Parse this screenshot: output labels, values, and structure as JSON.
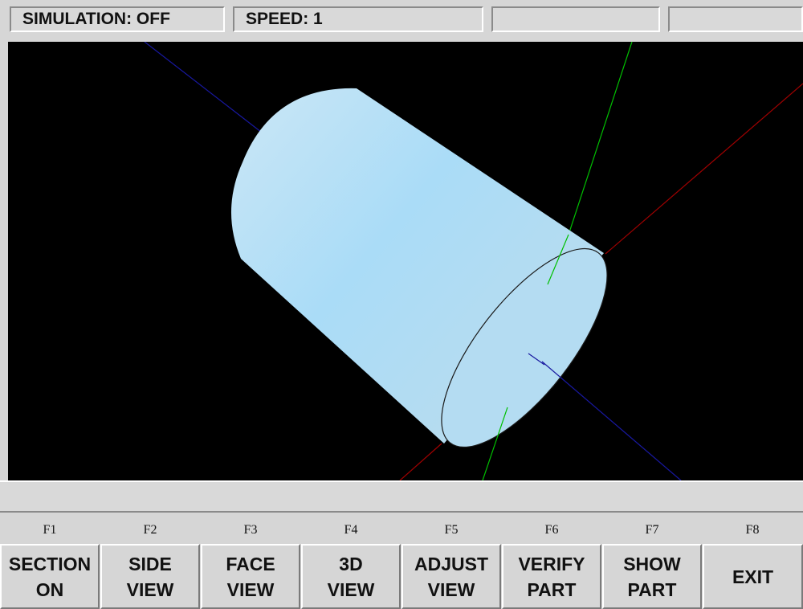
{
  "status_bar": {
    "simulation": "SIMULATION: OFF",
    "speed": "SPEED: 1",
    "field3": "",
    "field4": ""
  },
  "viewport": {
    "background": "#000000",
    "part_color": "#a9dcf5",
    "axis_colors": {
      "x": "#a00000",
      "y": "#00c000",
      "z": "#1010a0"
    }
  },
  "message_bar": {
    "text": ""
  },
  "function_keys": [
    {
      "key": "F1",
      "line1": "SECTION",
      "line2": "ON"
    },
    {
      "key": "F2",
      "line1": "SIDE",
      "line2": "VIEW"
    },
    {
      "key": "F3",
      "line1": "FACE",
      "line2": "VIEW"
    },
    {
      "key": "F4",
      "line1": "3D",
      "line2": "VIEW"
    },
    {
      "key": "F5",
      "line1": "ADJUST",
      "line2": "VIEW"
    },
    {
      "key": "F6",
      "line1": "VERIFY",
      "line2": "PART"
    },
    {
      "key": "F7",
      "line1": "SHOW",
      "line2": "PART"
    },
    {
      "key": "F8",
      "line1": "EXIT",
      "line2": ""
    }
  ]
}
